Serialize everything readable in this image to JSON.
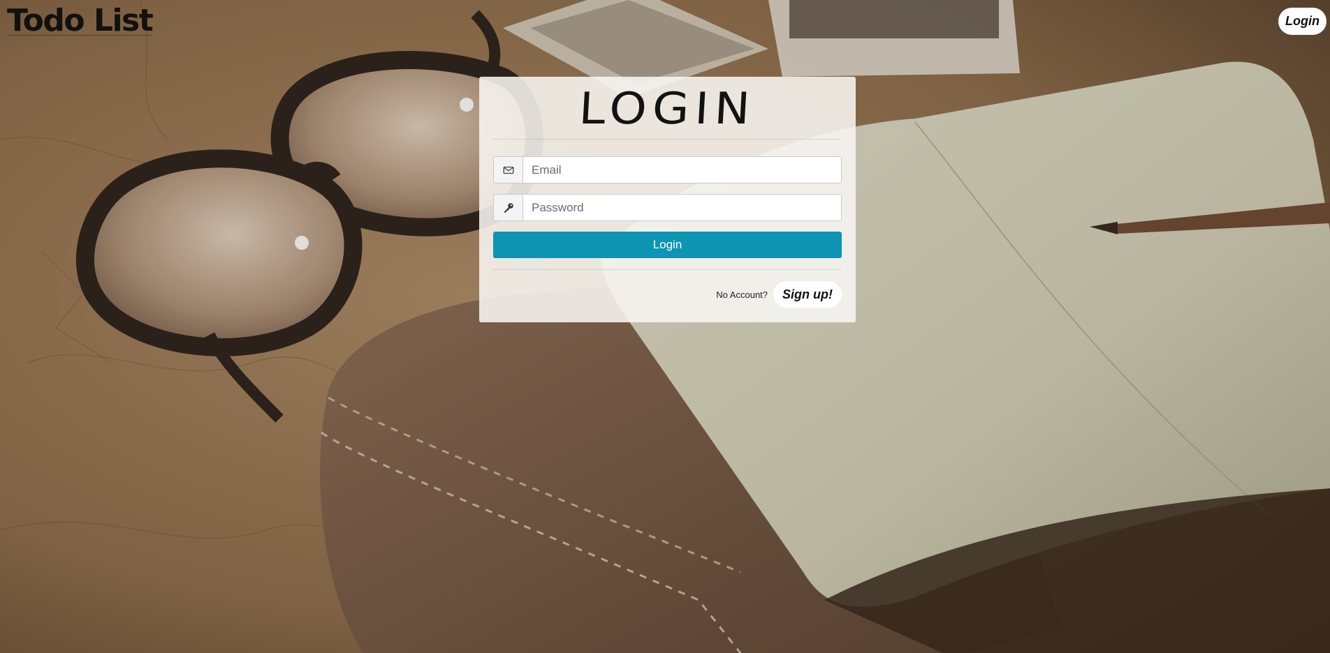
{
  "header": {
    "brand": "Todo List",
    "login_label": "Login"
  },
  "card": {
    "title": "LOGIN",
    "email": {
      "placeholder": "Email",
      "value": "",
      "icon": "envelope-icon"
    },
    "password": {
      "placeholder": "Password",
      "value": "",
      "icon": "key-icon"
    },
    "submit_label": "Login",
    "no_account_text": "No Account?",
    "signup_label": "Sign up!"
  },
  "colors": {
    "primary_button": "#0d95b3",
    "card_background": "#f8f6f3"
  }
}
